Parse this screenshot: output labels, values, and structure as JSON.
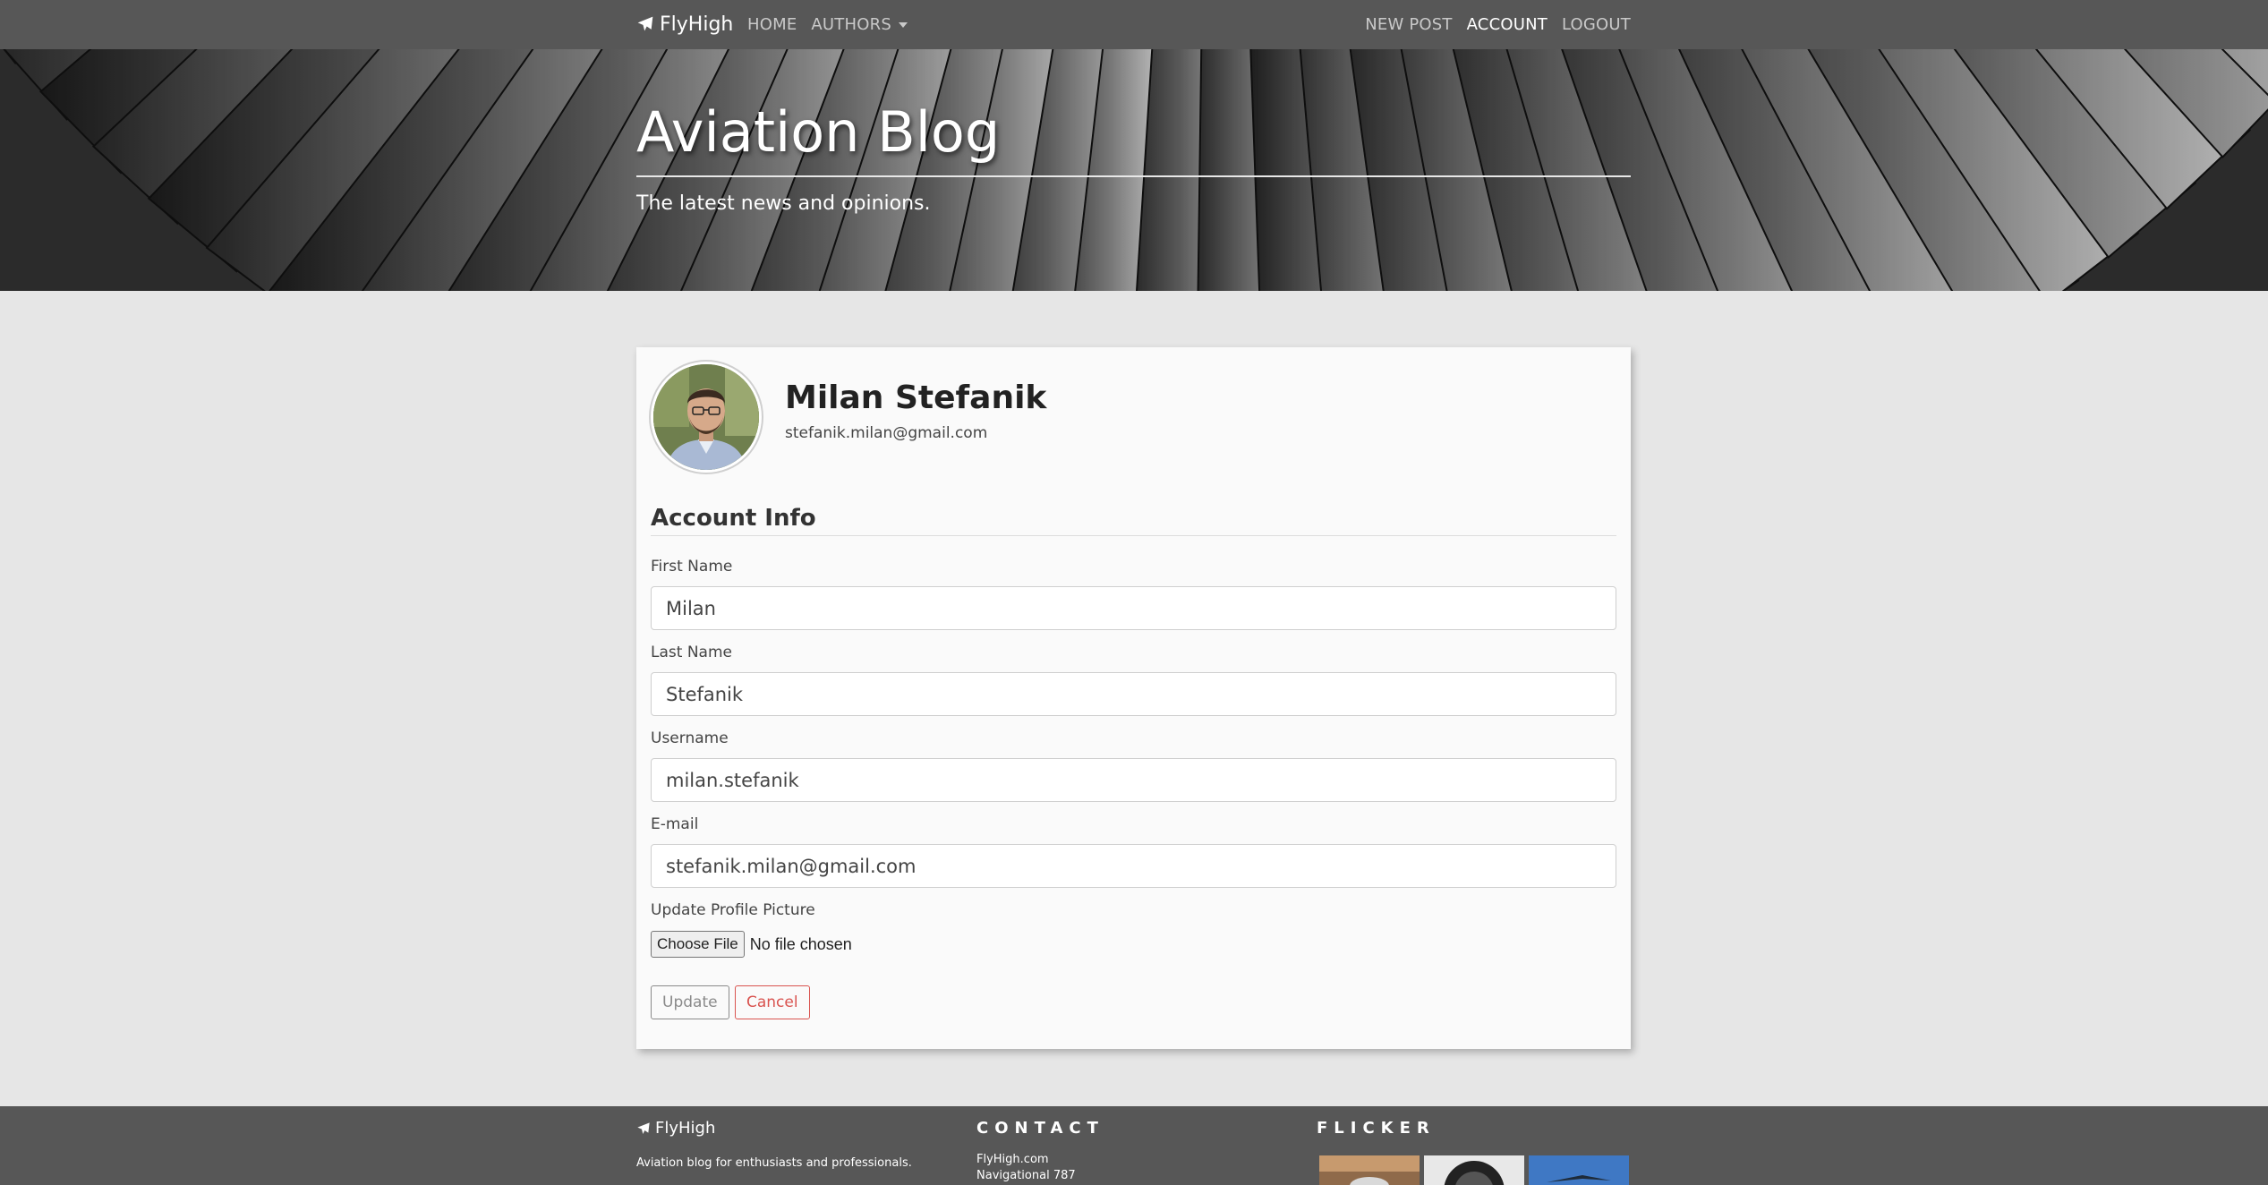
{
  "navbar": {
    "brand": "FlyHigh",
    "left_links": [
      {
        "label": "HOME"
      },
      {
        "label": "AUTHORS"
      }
    ],
    "right_links": [
      {
        "label": "NEW POST"
      },
      {
        "label": "ACCOUNT"
      },
      {
        "label": "LOGOUT"
      }
    ]
  },
  "hero": {
    "title": "Aviation Blog",
    "subtitle": "The latest news and opinions."
  },
  "profile": {
    "name": "Milan Stefanik",
    "email": "stefanik.milan@gmail.com"
  },
  "form": {
    "section_title": "Account Info",
    "first_name": {
      "label": "First Name",
      "value": "Milan"
    },
    "last_name": {
      "label": "Last Name",
      "value": "Stefanik"
    },
    "username": {
      "label": "Username",
      "value": "milan.stefanik"
    },
    "email": {
      "label": "E-mail",
      "value": "stefanik.milan@gmail.com"
    },
    "picture": {
      "label": "Update Profile Picture",
      "button": "Choose File",
      "status": "No file chosen"
    },
    "update_label": "Update",
    "cancel_label": "Cancel"
  },
  "footer": {
    "brand": "FlyHigh",
    "tagline": "Aviation blog for enthusiasts and professionals.",
    "contact_heading": "CONTACT",
    "contact_lines": [
      "FlyHigh.com",
      "Navigational 787"
    ],
    "flicker_heading": "FLICKER"
  },
  "colors": {
    "navbar": "#575757",
    "page_background": "#e6e6e6",
    "card": "#fafafa",
    "cancel": "#d9534f"
  },
  "icons": {
    "brand": "paper-plane-icon",
    "authors_dropdown": "caret-down-icon"
  }
}
